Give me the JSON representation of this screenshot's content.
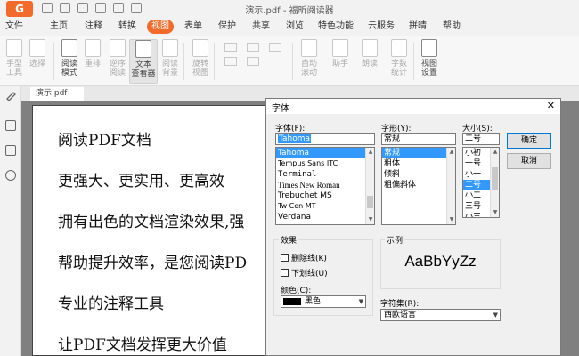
{
  "window": {
    "title": "演示.pdf - 福昕阅读器"
  },
  "menu": [
    {
      "label": "文件"
    },
    {
      "label": "主页"
    },
    {
      "label": "注释"
    },
    {
      "label": "转换"
    },
    {
      "label": "视图",
      "active": true
    },
    {
      "label": "表单"
    },
    {
      "label": "保护"
    },
    {
      "label": "共享"
    },
    {
      "label": "浏览"
    },
    {
      "label": "特色功能"
    },
    {
      "label": "云服务"
    },
    {
      "label": "拼晴"
    },
    {
      "label": "帮助"
    }
  ],
  "ribbon": {
    "tools": [
      {
        "label": "手型\n工具",
        "icon": "hand-icon"
      },
      {
        "label": "选择",
        "icon": "select-icon"
      },
      {
        "label": "阅读\n模式",
        "icon": "read-mode-icon"
      },
      {
        "label": "重排",
        "icon": "reflow-icon"
      },
      {
        "label": "逆序\n阅读",
        "icon": "reverse-read-icon"
      },
      {
        "label": "文本\n查看器",
        "icon": "text-viewer-icon"
      },
      {
        "label": "阅读\n背景",
        "icon": "read-background-icon"
      },
      {
        "label": "旋转\n视图",
        "icon": "rotate-view-icon"
      },
      {
        "label": "自动\n滚动",
        "icon": "auto-scroll-icon"
      },
      {
        "label": "助手",
        "icon": "assistant-icon"
      },
      {
        "label": "朗读",
        "icon": "read-aloud-icon"
      },
      {
        "label": "字数\n统计",
        "icon": "word-count-icon"
      },
      {
        "label": "视图\n设置",
        "icon": "view-settings-icon"
      }
    ]
  },
  "sidebar": {
    "icons": [
      "bookmark-icon",
      "pages-icon",
      "comment-icon"
    ]
  },
  "document": {
    "tab_label": "演示.pdf",
    "lines": [
      "阅读PDF文档",
      "更强大、更实用、更高效",
      "拥有出色的文档渲染效果,强",
      "帮助提升效率，是您阅读PD",
      "专业的注释工具",
      "让PDF文档发挥更大价值"
    ]
  },
  "font_dialog": {
    "title": "字体",
    "close_label": "✕",
    "font_label": "字体(F):",
    "font_value": "Tahoma",
    "fonts": [
      "Tahoma",
      "Tempus Sans ITC",
      "Terminal",
      "Times New Roman",
      "Trebuchet MS",
      "Tw Cen MT",
      "Verdana"
    ],
    "selected_font": "Tahoma",
    "style_label": "字形(Y):",
    "style_value": "常规",
    "styles": [
      "常规",
      "粗体",
      "倾斜",
      "粗偏斜体"
    ],
    "selected_style": "常规",
    "size_label": "大小(S):",
    "size_value": "二号",
    "sizes": [
      "小初",
      "一号",
      "小一",
      "二号",
      "小二",
      "三号",
      "小三"
    ],
    "selected_size": "二号",
    "ok_label": "确定",
    "cancel_label": "取消",
    "effects_label": "效果",
    "strikeout_label": "删除线(K)",
    "underline_label": "下划线(U)",
    "color_label": "颜色(C):",
    "color_value": "黑色",
    "color_hex": "#000000",
    "sample_label": "示例",
    "sample_text": "AaBbYyZz",
    "charset_label": "字符集(R):",
    "charset_value": "西欧语言"
  },
  "colors": {
    "accent": "#f26b2b",
    "selection": "#3399ff"
  }
}
